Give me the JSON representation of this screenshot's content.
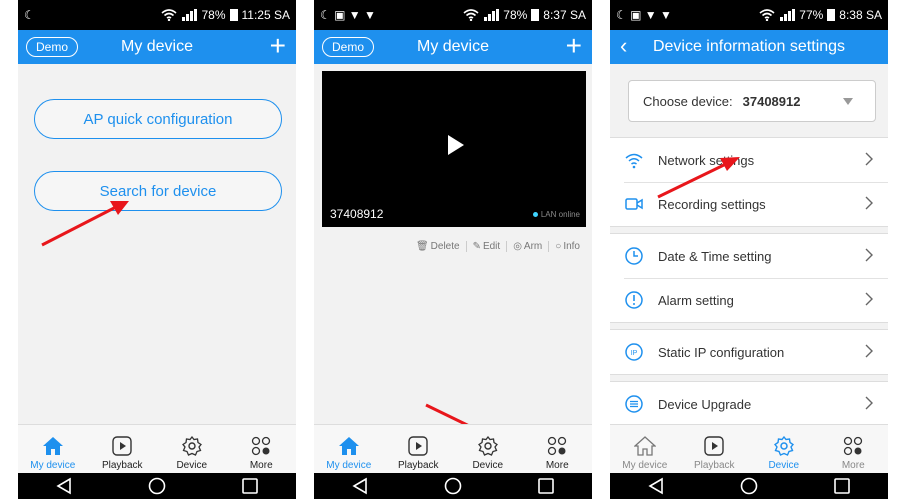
{
  "status_bars": [
    {
      "left": "☾",
      "right_text": "78%",
      "time": "11:25 SA"
    },
    {
      "left": "☾ ▣ ▼ ▼",
      "right_text": "78%",
      "time": "8:37 SA"
    },
    {
      "left": "☾ ▣ ▼ ▼",
      "right_text": "77%",
      "time": "8:38 SA"
    }
  ],
  "screen1": {
    "demo": "Demo",
    "title": "My device",
    "ap_button": "AP quick configuration",
    "search_button": "Search for device"
  },
  "screen2": {
    "demo": "Demo",
    "title": "My device",
    "device_id": "37408912",
    "device_status": "LAN online",
    "actions": [
      "Delete",
      "Edit",
      "Arm",
      "Info"
    ]
  },
  "screen3": {
    "title": "Device information settings",
    "choose_label": "Choose device:",
    "choose_value": "37408912",
    "rows": [
      "Network settings",
      "Recording settings",
      "Date & Time setting",
      "Alarm setting",
      "Static IP configuration",
      "Device Upgrade"
    ]
  },
  "tabs": [
    "My device",
    "Playback",
    "Device",
    "More"
  ],
  "colors": {
    "accent": "#1e90ee",
    "arrow": "#e8161b"
  }
}
